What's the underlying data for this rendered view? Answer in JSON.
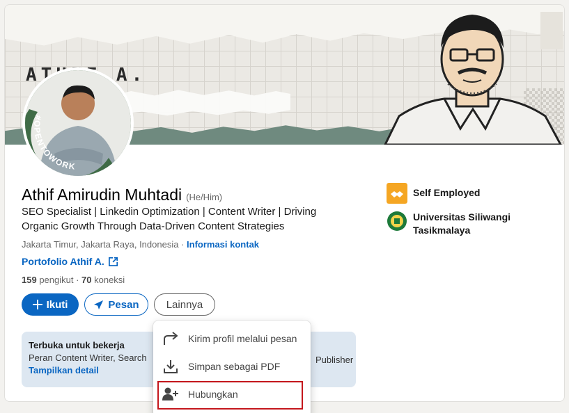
{
  "banner": {
    "name_text": "ATHIF A."
  },
  "avatar": {
    "frame_text": "#OPENTOWORK"
  },
  "profile": {
    "name": "Athif Amirudin Muhtadi",
    "pronouns": "(He/Him)",
    "headline": "SEO Specialist | Linkedin Optimization | Content Writer | Driving Organic Growth Through Data-Driven Content Strategies",
    "location": "Jakarta Timur, Jakarta Raya, Indonesia",
    "separator": " · ",
    "contact_link": "Informasi kontak",
    "portfolio_link": "Portofolio Athif A.",
    "followers_count": "159",
    "followers_label": " pengikut",
    "connections_sep": " · ",
    "connections_count": "70",
    "connections_label": " koneksi"
  },
  "actions": {
    "follow_label": "Ikuti",
    "message_label": "Pesan",
    "more_label": "Lainnya"
  },
  "open_to_work": {
    "title": "Terbuka untuk bekerja",
    "text": "Peran Content Writer, Search",
    "text_right": "Publisher",
    "link": "Tampilkan detail"
  },
  "experience": {
    "company": "Self Employed",
    "school": "Universitas Siliwangi Tasikmalaya"
  },
  "dropdown": {
    "items": [
      {
        "label": "Kirim profil melalui pesan",
        "icon": "share-arrow-icon"
      },
      {
        "label": "Simpan sebagai PDF",
        "icon": "download-icon"
      },
      {
        "label": "Hubungkan",
        "icon": "add-person-icon"
      }
    ]
  },
  "colors": {
    "primary": "#0a66c2",
    "open_to_work_bg": "#dde7f1",
    "highlight": "#c4161c",
    "otw_green": "#3f6b46"
  }
}
